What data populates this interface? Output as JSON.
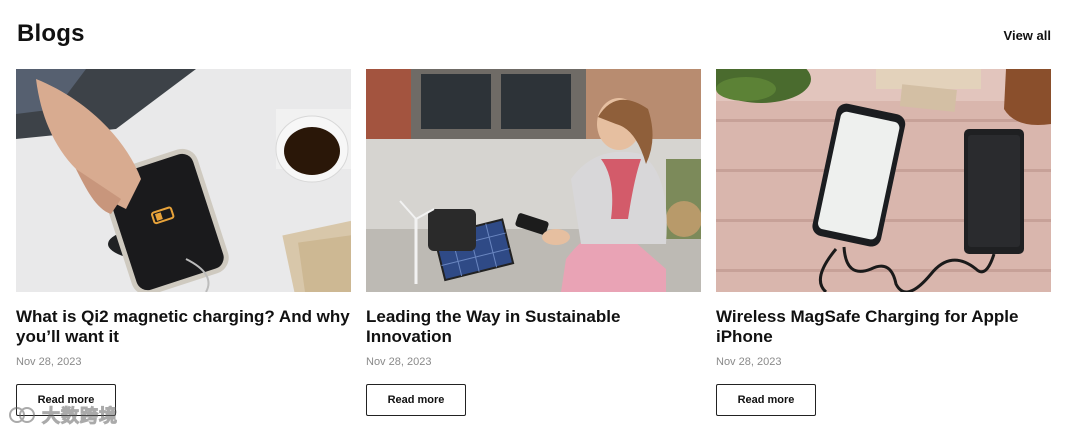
{
  "section": {
    "title": "Blogs",
    "view_all": "View all"
  },
  "cards": [
    {
      "image_icon": "wireless-charger-phone-image",
      "title": "What is Qi2 magnetic charging? And why you’ll want it",
      "date": "Nov 28, 2023",
      "button": "Read more"
    },
    {
      "image_icon": "solar-panel-woman-image",
      "title": "Leading the Way in Sustainable Innovation",
      "date": "Nov 28, 2023",
      "button": "Read more"
    },
    {
      "image_icon": "phone-powerbank-image",
      "title": "Wireless MagSafe Charging for Apple iPhone",
      "date": "Nov 28, 2023",
      "button": "Read more"
    }
  ],
  "watermark": {
    "text": "大数跨境"
  }
}
